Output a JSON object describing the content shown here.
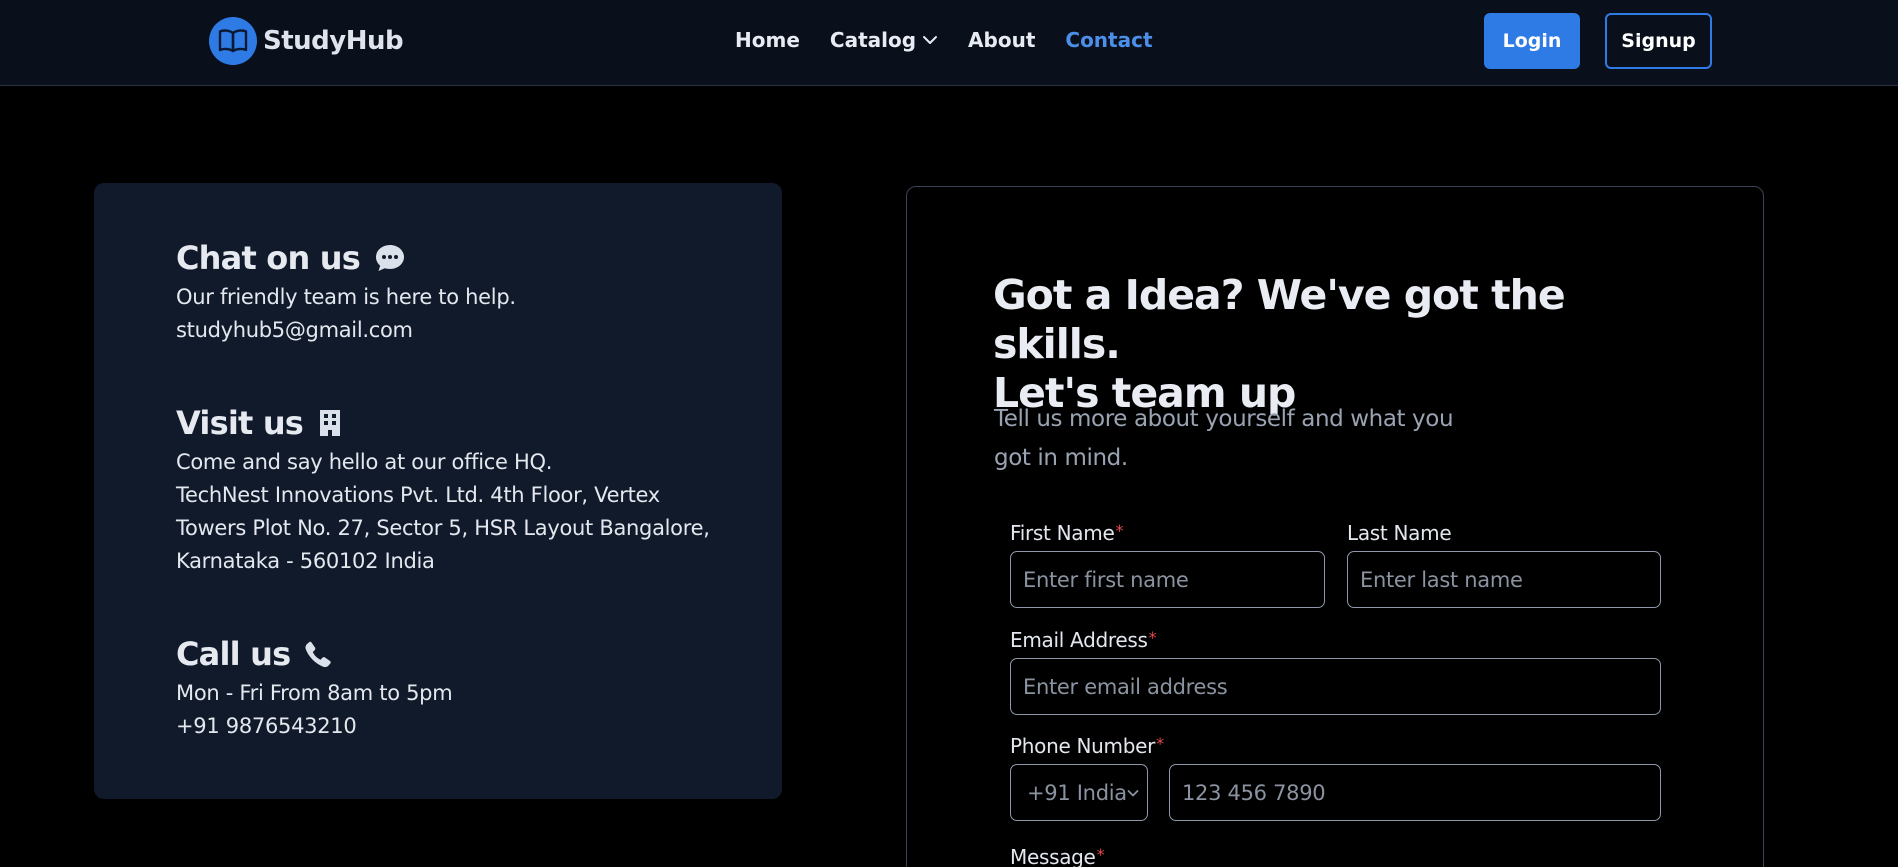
{
  "brand": {
    "name": "StudyHub",
    "accent": "#2f7be6"
  },
  "nav": {
    "links": [
      "Home",
      "Catalog",
      "About",
      "Contact"
    ],
    "active": "Contact"
  },
  "auth": {
    "login": "Login",
    "signup": "Signup"
  },
  "contact_info": {
    "chat": {
      "heading": "Chat on us",
      "icon": "chat-bubble-icon",
      "lines": [
        "Our friendly team is here to help.",
        "studyhub5@gmail.com"
      ]
    },
    "visit": {
      "heading": "Visit us",
      "icon": "building-icon",
      "lines": [
        "Come and say hello at our office HQ.",
        "TechNest Innovations Pvt. Ltd. 4th Floor, Vertex",
        "Towers Plot No. 27, Sector 5, HSR Layout Bangalore,",
        "Karnataka - 560102 India"
      ]
    },
    "call": {
      "heading": "Call us",
      "icon": "phone-icon",
      "lines": [
        "Mon - Fri From 8am to 5pm",
        "+91 9876543210"
      ]
    }
  },
  "form": {
    "title_line1": "Got a Idea? We've got the skills.",
    "title_line2": "Let's team up",
    "subtitle_line1": "Tell us more about yourself and what you",
    "subtitle_line2": "got in mind.",
    "first_name": {
      "label": "First Name",
      "placeholder": "Enter first name",
      "required": true
    },
    "last_name": {
      "label": "Last Name",
      "placeholder": "Enter last name",
      "required": false
    },
    "email": {
      "label": "Email Address",
      "placeholder": "Enter email address",
      "required": true
    },
    "phone": {
      "label": "Phone Number",
      "country": "+91 India",
      "placeholder": "123 456 7890",
      "required": true
    },
    "message": {
      "label": "Message",
      "required": true
    },
    "required_mark": "*"
  }
}
